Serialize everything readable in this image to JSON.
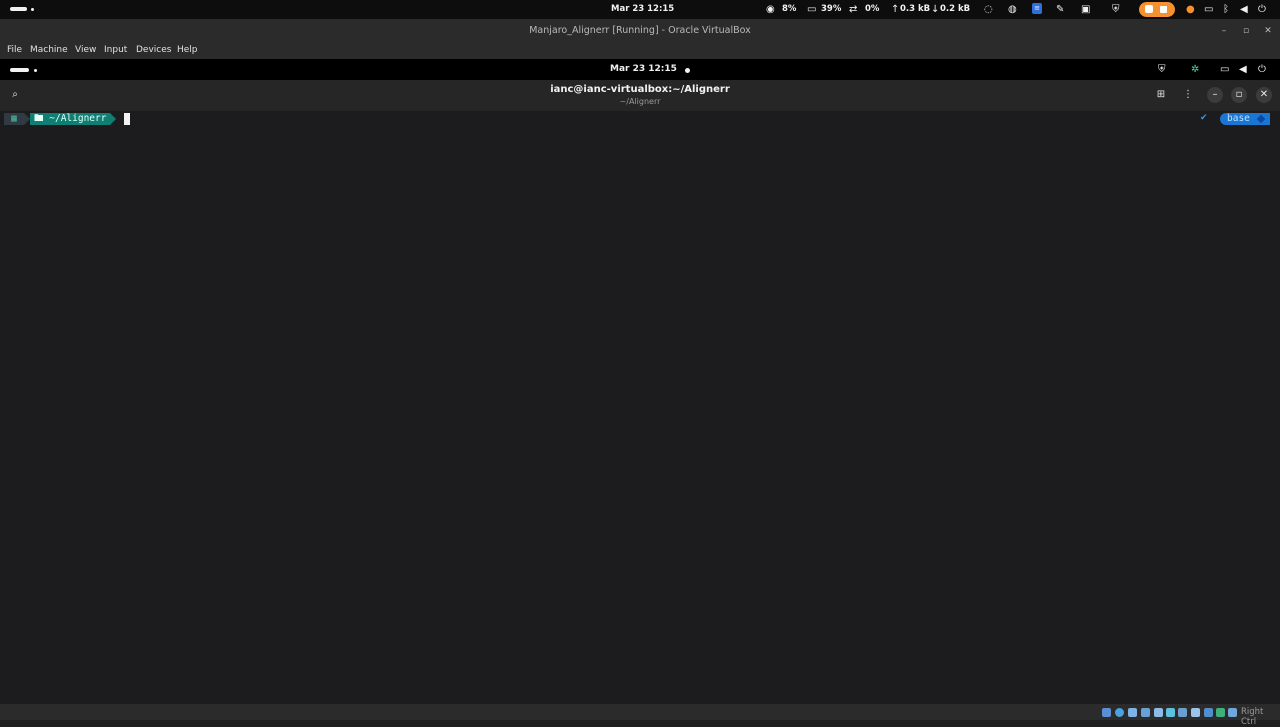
{
  "host_bar": {
    "clock": "Mar 23  12:15",
    "cpu": "8%",
    "memory": "39%",
    "swap": "0%",
    "net_up": "0.3 kB",
    "net_down": "0.2 kB",
    "icons": [
      "globe-icon",
      "monitor-icon",
      "swap-icon",
      "arrow-up-icon",
      "arrow-down-icon",
      "obs-icon",
      "discord-icon",
      "notes-icon",
      "pen-icon",
      "clipboard-icon",
      "shield-icon",
      "screen-record-icon",
      "microphone-icon",
      "bluetooth-icon",
      "display-icon",
      "volume-icon",
      "power-icon"
    ]
  },
  "window": {
    "title": "Manjaro_Alignerr [Running] - Oracle VirtualBox",
    "controls": {
      "minimize": "–",
      "maximize": "▫",
      "close": "✕"
    }
  },
  "menu": {
    "items": [
      "File",
      "Machine",
      "View",
      "Input",
      "Devices",
      "Help"
    ]
  },
  "guest_bar": {
    "clock": "Mar 23  12:15"
  },
  "terminal": {
    "title": "ianc@ianc-virtualbox:~/Alignerr",
    "subtitle": "~/Alignerr",
    "prompt": {
      "os_glyph": "▦",
      "dir_glyph": "🖿",
      "dir": "~/Alignerr",
      "check": "✔",
      "env": "base"
    }
  },
  "status_bar": {
    "host_key": "Right Ctrl"
  },
  "colors": {
    "terminal_bg": "#1c1c1e",
    "dir_segment": "#0f7f74",
    "env_segment": "#1976d2",
    "record_badge": "#f5922f"
  }
}
